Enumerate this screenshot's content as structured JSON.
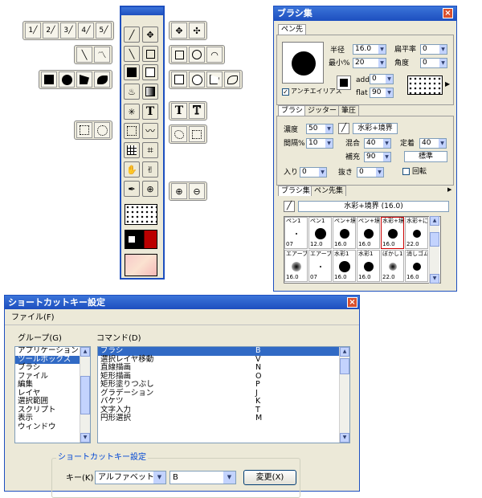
{
  "toolbox": {
    "left_groups": {
      "brush_sizes": [
        "1",
        "2",
        "3",
        "4",
        "5"
      ]
    },
    "tools": {
      "text_label": "T",
      "text_outline_label": "T"
    }
  },
  "brush_panel": {
    "title": "ブラシ集",
    "tip_tab": "ペン先",
    "size_label": "半径",
    "size_value": "16.0",
    "flatness_label": "扁平率",
    "flatness_value": "0",
    "min_size_label": "最小%",
    "min_size_value": "20",
    "angle_label": "角度",
    "angle_value": "0",
    "antialias_label": "アンチエイリアス",
    "add_label": "add",
    "add_value": "0",
    "flat_label": "flat",
    "flat_value": "90",
    "tabs": [
      "ブラシ",
      "ジッター",
      "筆圧"
    ],
    "density_label": "濃度",
    "density_value": "50",
    "blend_name": "水彩+境界",
    "interval_label": "間隔%",
    "interval_value": "10",
    "mix_label": "混合",
    "mix_value": "40",
    "fix_label": "定着",
    "fix_value": "40",
    "saturation_label": "補充",
    "saturation_value": "90",
    "mode_value": "標準",
    "in_label": "入り",
    "in_value": "0",
    "out_label": "抜き",
    "out_value": "0",
    "rotate_label": "回転",
    "set_tabs": [
      "ブラシ集",
      "ペン先集"
    ],
    "current_brush": "水彩+境界 (16.0)",
    "grid_headers_1": [
      "ペン1",
      "ペン1",
      "ペン+境",
      "ペン+境",
      "水彩+境",
      "水彩+に"
    ],
    "grid_sizes_1": [
      "07",
      "12.0",
      "16.0",
      "16.0",
      "16.0",
      "22.0"
    ],
    "grid_headers_2": [
      "エアーブ",
      "エアーブ",
      "水彩1",
      "水彩1",
      "ぼかし1",
      "消しゴム"
    ],
    "grid_sizes_2": [
      "16.0",
      "07",
      "16.0",
      "16.0",
      "22.0",
      "16.0"
    ]
  },
  "shortcut_dialog": {
    "title": "ショートカットキー設定",
    "menu_file": "ファイル(F)",
    "group_label": "グループ(G)",
    "command_label": "コマンド(D)",
    "groups": [
      "アプリケーション",
      "ツールボックス",
      "ブラシ",
      "ファイル",
      "編集",
      "レイヤ",
      "選択範囲",
      "スクリプト",
      "表示",
      "ウィンドウ"
    ],
    "selected_group_index": 1,
    "commands": [
      {
        "name": "ブラシ",
        "key": "B"
      },
      {
        "name": "選択レイヤ移動",
        "key": "V"
      },
      {
        "name": "直線描画",
        "key": "N"
      },
      {
        "name": "矩形描画",
        "key": "O"
      },
      {
        "name": "矩形塗りつぶし",
        "key": "P"
      },
      {
        "name": "グラデーション",
        "key": "J"
      },
      {
        "name": "バケツ",
        "key": "K"
      },
      {
        "name": "文字入力",
        "key": "T"
      },
      {
        "name": "円形選択",
        "key": "M"
      }
    ],
    "shortcut_group_label": "ショートカットキー設定",
    "key_label": "キー(K)",
    "key_type": "アルファベット",
    "key_value": "B",
    "change_button": "変更(X)"
  }
}
